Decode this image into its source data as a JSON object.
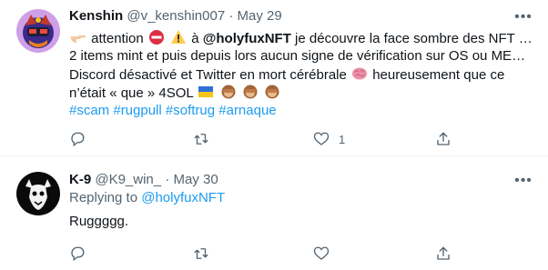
{
  "tweets": [
    {
      "name": "Kenshin",
      "handle": "@v_kenshin007",
      "separator": "·",
      "date": "May 29",
      "body": {
        "l1_a": "attention",
        "l1_b": "à",
        "l1_mention": "@holyfuxNFT",
        "l1_c": "je découvre la face sombre des NFT …",
        "l2": "2 items mint et puis depuis lors aucun signe de vérification sur OS ou ME…",
        "l3_a": "Discord désactivé et Twitter en mort cérébrale",
        "l3_b": "heureusement que ce",
        "l4": "n’était « que » 4SOL",
        "hashtags": "#scam #rugpull #softrug #arnaque"
      },
      "icons": [
        "pointing-hand-icon",
        "no-entry-icon",
        "warning-icon",
        "brain-icon",
        "flag-icon",
        "see-no-evil-monkey-icon"
      ],
      "actions": {
        "reply_count": "",
        "retweet_count": "",
        "like_count": "1",
        "share_count": ""
      }
    },
    {
      "name": "K-9",
      "handle": "@K9_win_",
      "separator": "·",
      "date": "May 30",
      "replying_prefix": "Replying to",
      "replying_to": "@holyfuxNFT",
      "text": "Ruggggg.",
      "actions": {
        "reply_count": "",
        "retweet_count": "",
        "like_count": "",
        "share_count": ""
      }
    }
  ],
  "colors": {
    "accent": "#1d9bf0",
    "text": "#0f1419",
    "muted": "#536471",
    "divider": "#eff3f4"
  }
}
